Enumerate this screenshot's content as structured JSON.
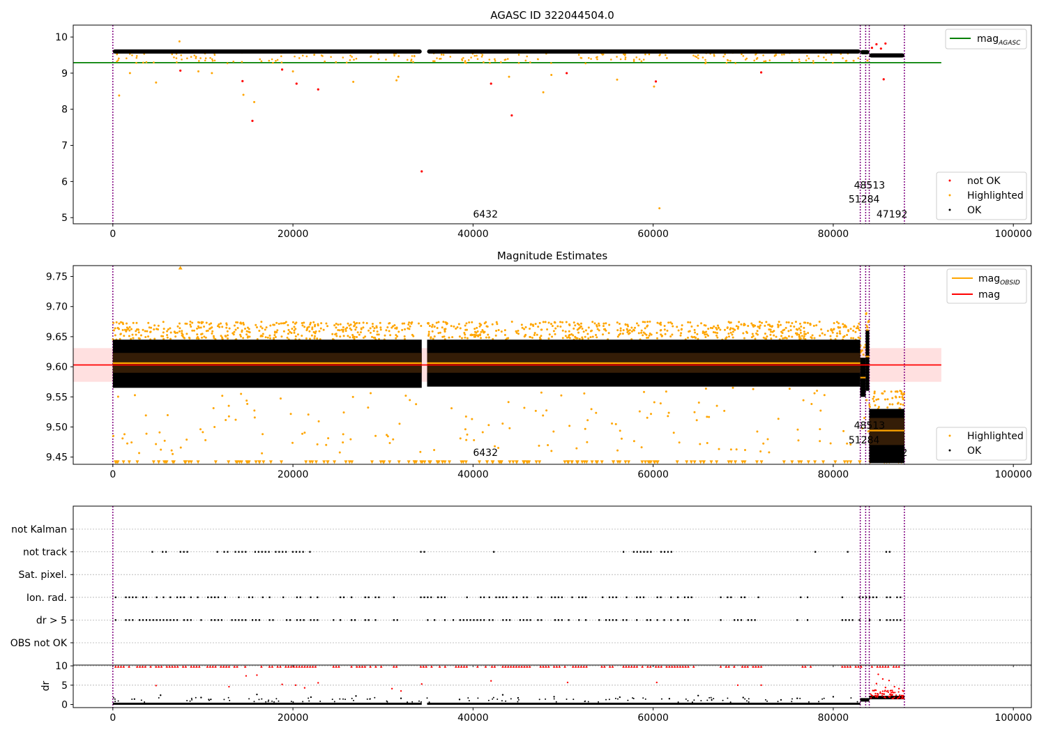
{
  "colors": {
    "ok": "#000000",
    "highlighted": "#ffa500",
    "not_ok": "#ff0000",
    "agasc_line": "#008000",
    "obsid_line": "#ffa500",
    "mag_line": "#ff0000",
    "mag_band": "#ffcccc",
    "obs_divider": "#800080",
    "grid": "#b0b0b0"
  },
  "chart_data": [
    {
      "type": "scatter",
      "title": "AGASC ID 322044504.0",
      "xlim": [
        -4400,
        102000
      ],
      "ylim": [
        4.83,
        10.33
      ],
      "xticks": [
        0,
        20000,
        40000,
        60000,
        80000,
        100000
      ],
      "xtick_labels": [
        "0",
        "20000",
        "40000",
        "60000",
        "80000",
        "100000"
      ],
      "yticks": [
        5,
        6,
        7,
        8,
        9,
        10
      ],
      "ytick_labels": [
        "5",
        "6",
        "7",
        "8",
        "9",
        "10"
      ],
      "obs_boundaries": [
        0,
        83000,
        83600,
        84000,
        87900
      ],
      "obsid_labels": [
        {
          "text": "6432",
          "x": 40000,
          "y": 5.0
        },
        {
          "text": "48513",
          "x": 82300,
          "y": 5.8
        },
        {
          "text": "51284",
          "x": 81700,
          "y": 5.42
        },
        {
          "text": "47192",
          "x": 84800,
          "y": 5.0
        }
      ],
      "hlines": [
        {
          "name": "mag_AGASC",
          "y": 9.29,
          "x_range": [
            -4400,
            92000
          ]
        }
      ],
      "series_legend": [
        "not OK",
        "Highlighted",
        "OK"
      ],
      "line_legend": {
        "main": "mag",
        "sub": "AGASC"
      },
      "ok_segments": [
        {
          "x_start": 0,
          "x_end": 34300,
          "y": 9.6
        },
        {
          "x_start": 34900,
          "x_end": 83000,
          "y": 9.6
        },
        {
          "x_start": 83000,
          "x_end": 84000,
          "y": 9.58
        },
        {
          "x_start": 84000,
          "x_end": 87900,
          "y": 9.49
        }
      ],
      "not_ok_points": [
        {
          "x": 7500,
          "y": 9.07
        },
        {
          "x": 14400,
          "y": 8.78
        },
        {
          "x": 15500,
          "y": 7.68
        },
        {
          "x": 18800,
          "y": 9.1
        },
        {
          "x": 20400,
          "y": 8.71
        },
        {
          "x": 22800,
          "y": 8.55
        },
        {
          "x": 34300,
          "y": 6.28
        },
        {
          "x": 42000,
          "y": 8.71
        },
        {
          "x": 44300,
          "y": 7.83
        },
        {
          "x": 50400,
          "y": 9.0
        },
        {
          "x": 60300,
          "y": 8.77
        },
        {
          "x": 72000,
          "y": 9.02
        },
        {
          "x": 84300,
          "y": 9.7
        },
        {
          "x": 84800,
          "y": 9.8
        },
        {
          "x": 85300,
          "y": 9.68
        },
        {
          "x": 85800,
          "y": 9.82
        },
        {
          "x": 85600,
          "y": 8.83
        }
      ],
      "highlighted_points": [
        {
          "x": 700,
          "y": 8.38
        },
        {
          "x": 7400,
          "y": 9.88
        },
        {
          "x": 14500,
          "y": 8.4
        },
        {
          "x": 15700,
          "y": 8.2
        },
        {
          "x": 26700,
          "y": 8.76
        },
        {
          "x": 31500,
          "y": 8.8
        },
        {
          "x": 31700,
          "y": 8.9
        },
        {
          "x": 44000,
          "y": 8.9
        },
        {
          "x": 47800,
          "y": 8.47
        },
        {
          "x": 48700,
          "y": 8.95
        },
        {
          "x": 56000,
          "y": 8.82
        },
        {
          "x": 60100,
          "y": 8.63
        },
        {
          "x": 60700,
          "y": 5.26
        },
        {
          "x": 1900,
          "y": 9.0
        },
        {
          "x": 4800,
          "y": 8.74
        },
        {
          "x": 9500,
          "y": 9.05
        },
        {
          "x": 11000,
          "y": 9.0
        },
        {
          "x": 20000,
          "y": 9.05
        },
        {
          "x": 83800,
          "y": 9.35
        }
      ]
    },
    {
      "type": "scatter",
      "title": "Magnitude Estimates",
      "xlim": [
        -4400,
        102000
      ],
      "ylim": [
        9.438,
        9.768
      ],
      "xticks": [
        0,
        20000,
        40000,
        60000,
        80000,
        100000
      ],
      "xtick_labels": [
        "0",
        "20000",
        "40000",
        "60000",
        "80000",
        "100000"
      ],
      "yticks": [
        9.45,
        9.5,
        9.55,
        9.6,
        9.65,
        9.7,
        9.75
      ],
      "ytick_labels": [
        "9.45",
        "9.50",
        "9.55",
        "9.60",
        "9.65",
        "9.70",
        "9.75"
      ],
      "obs_boundaries": [
        0,
        83000,
        83600,
        84000,
        87900
      ],
      "obsid_labels": [
        {
          "text": "6432",
          "x": 40000,
          "y": 9.452
        },
        {
          "text": "48513",
          "x": 82300,
          "y": 9.497
        },
        {
          "text": "51284",
          "x": 81700,
          "y": 9.473
        },
        {
          "text": "47192",
          "x": 84800,
          "y": 9.452
        }
      ],
      "mag": 9.603,
      "mag_band": [
        9.575,
        9.631
      ],
      "band_x_range": [
        -4400,
        92000
      ],
      "obsid_mags": [
        {
          "x_start": 0,
          "x_end": 34300,
          "y": 9.606
        },
        {
          "x_start": 34900,
          "x_end": 83000,
          "y": 9.606
        },
        {
          "x_start": 83000,
          "x_end": 83600,
          "y": 9.582
        },
        {
          "x_start": 83600,
          "x_end": 84000,
          "y": 9.617
        },
        {
          "x_start": 84000,
          "x_end": 87900,
          "y": 9.494
        }
      ],
      "ok_blocks": [
        {
          "x_start": 0,
          "x_end": 34300,
          "y_low": 9.565,
          "y_high": 9.645
        },
        {
          "x_start": 34900,
          "x_end": 83000,
          "y_low": 9.567,
          "y_high": 9.645
        },
        {
          "x_start": 83000,
          "x_end": 83600,
          "y_low": 9.55,
          "y_high": 9.615
        },
        {
          "x_start": 83600,
          "x_end": 84000,
          "y_low": 9.56,
          "y_high": 9.66
        },
        {
          "x_start": 84000,
          "x_end": 87900,
          "y_low": 9.44,
          "y_high": 9.53
        }
      ],
      "core_blocks": [
        {
          "x_start": 0,
          "x_end": 34300,
          "y_low": 9.59,
          "y_high": 9.623
        },
        {
          "x_start": 34900,
          "x_end": 83000,
          "y_low": 9.59,
          "y_high": 9.623
        },
        {
          "x_start": 84000,
          "x_end": 87900,
          "y_low": 9.47,
          "y_high": 9.515
        }
      ],
      "clipped_y": 9.441,
      "series_legend": [
        "Highlighted",
        "OK"
      ],
      "line_legend": [
        {
          "main": "mag",
          "sub": "OBSID"
        },
        {
          "main": "mag",
          "sub": ""
        }
      ]
    },
    {
      "type": "scatter",
      "title": "",
      "xlim": [
        -4400,
        102000
      ],
      "categories": [
        "not Kalman",
        "not track",
        "Sat. pixel.",
        "Ion. rad.",
        "dr > 5",
        "OBS not OK"
      ],
      "obs_boundaries": [
        0,
        83000,
        83600,
        84000,
        87900
      ],
      "flag_ranges": [
        {
          "flag": "not track",
          "ranges": [
            [
              4000,
              6000
            ],
            [
              7500,
              8500
            ],
            [
              11600,
              12800
            ],
            [
              13600,
              14800
            ],
            [
              15800,
              22000
            ],
            [
              34200,
              35000
            ],
            [
              42300,
              44300
            ],
            [
              56700,
              62300
            ],
            [
              78000,
              78300
            ],
            [
              81600,
              81800
            ],
            [
              83900,
              84200
            ],
            [
              85500,
              86400
            ]
          ]
        },
        {
          "flag": "Ion. rad.",
          "ranges": [
            [
              300,
              22800
            ],
            [
              24500,
              25800
            ],
            [
              26500,
              29800
            ],
            [
              31200,
              31600
            ],
            [
              34200,
              37000
            ],
            [
              37800,
              41500
            ],
            [
              41800,
              46600
            ],
            [
              47200,
              52700
            ],
            [
              54000,
              64500
            ],
            [
              67500,
              72000
            ],
            [
              76000,
              77500
            ],
            [
              81000,
              87500
            ]
          ]
        },
        {
          "flag": "dr > 5",
          "ranges": [
            [
              300,
              22800
            ],
            [
              24500,
              25800
            ],
            [
              26500,
              29800
            ],
            [
              31200,
              31600
            ],
            [
              34200,
              37000
            ],
            [
              37800,
              41500
            ],
            [
              41800,
              46600
            ],
            [
              47200,
              52700
            ],
            [
              54000,
              64500
            ],
            [
              67500,
              72000
            ],
            [
              76000,
              77500
            ],
            [
              81000,
              87500
            ]
          ]
        }
      ]
    },
    {
      "type": "scatter",
      "title": "",
      "ylabel": "dr",
      "xlim": [
        -4400,
        102000
      ],
      "ylim": [
        -0.8,
        10.2
      ],
      "xticks": [
        0,
        20000,
        40000,
        60000,
        80000,
        100000
      ],
      "xtick_labels": [
        "0",
        "20000",
        "40000",
        "60000",
        "80000",
        "100000"
      ],
      "yticks": [
        0,
        5,
        10
      ],
      "ytick_labels": [
        "0",
        "5",
        "10"
      ],
      "obs_boundaries": [
        0,
        83000,
        83600,
        84000,
        87900
      ],
      "dr_capped_ranges": [
        [
          300,
          22800
        ],
        [
          24500,
          25800
        ],
        [
          26500,
          29800
        ],
        [
          31200,
          31600
        ],
        [
          34200,
          37000
        ],
        [
          37800,
          41500
        ],
        [
          41800,
          46600
        ],
        [
          47200,
          52700
        ],
        [
          54000,
          64500
        ],
        [
          67500,
          72000
        ],
        [
          76000,
          77500
        ],
        [
          81000,
          87500
        ]
      ],
      "dr_baseline": [
        {
          "x_start": 0,
          "x_end": 34300,
          "y": 0.2
        },
        {
          "x_start": 34900,
          "x_end": 83000,
          "y": 0.2
        },
        {
          "x_start": 83000,
          "x_end": 84000,
          "y": 1.2
        },
        {
          "x_start": 84000,
          "x_end": 87900,
          "y": 1.8
        }
      ],
      "dr_red_points": [
        {
          "x": 14800,
          "y": 7.4
        },
        {
          "x": 16000,
          "y": 7.6
        },
        {
          "x": 4800,
          "y": 4.9
        },
        {
          "x": 12900,
          "y": 4.6
        },
        {
          "x": 18800,
          "y": 5.2
        },
        {
          "x": 20300,
          "y": 5.0
        },
        {
          "x": 21300,
          "y": 4.3
        },
        {
          "x": 22800,
          "y": 5.6
        },
        {
          "x": 31000,
          "y": 4.1
        },
        {
          "x": 32000,
          "y": 3.5
        },
        {
          "x": 34300,
          "y": 5.3
        },
        {
          "x": 42000,
          "y": 6.1
        },
        {
          "x": 50500,
          "y": 5.7
        },
        {
          "x": 60400,
          "y": 5.7
        },
        {
          "x": 69400,
          "y": 5.0
        },
        {
          "x": 72000,
          "y": 5.0
        },
        {
          "x": 85000,
          "y": 7.8
        },
        {
          "x": 85500,
          "y": 6.6
        },
        {
          "x": 86200,
          "y": 6.2
        },
        {
          "x": 84800,
          "y": 5.4
        },
        {
          "x": 85800,
          "y": 4.4
        },
        {
          "x": 86800,
          "y": 4.6
        },
        {
          "x": 87300,
          "y": 4.1
        },
        {
          "x": 84400,
          "y": 3.6
        }
      ],
      "dr_black_points": [
        {
          "x": 5300,
          "y": 2.4
        },
        {
          "x": 9800,
          "y": 1.8
        },
        {
          "x": 16000,
          "y": 2.6
        },
        {
          "x": 22000,
          "y": 1.9
        },
        {
          "x": 27000,
          "y": 2.2
        },
        {
          "x": 32000,
          "y": 1.6
        },
        {
          "x": 43300,
          "y": 2.5
        },
        {
          "x": 45000,
          "y": 1.7
        },
        {
          "x": 49000,
          "y": 2.0
        },
        {
          "x": 61800,
          "y": 1.5
        },
        {
          "x": 65000,
          "y": 2.3
        },
        {
          "x": 70000,
          "y": 1.8
        },
        {
          "x": 76000,
          "y": 1.6
        },
        {
          "x": 80000,
          "y": 2.0
        },
        {
          "x": 2400,
          "y": 1.4
        },
        {
          "x": 38500,
          "y": 1.3
        },
        {
          "x": 56300,
          "y": 1.9
        },
        {
          "x": 74200,
          "y": 1.2
        }
      ]
    }
  ]
}
